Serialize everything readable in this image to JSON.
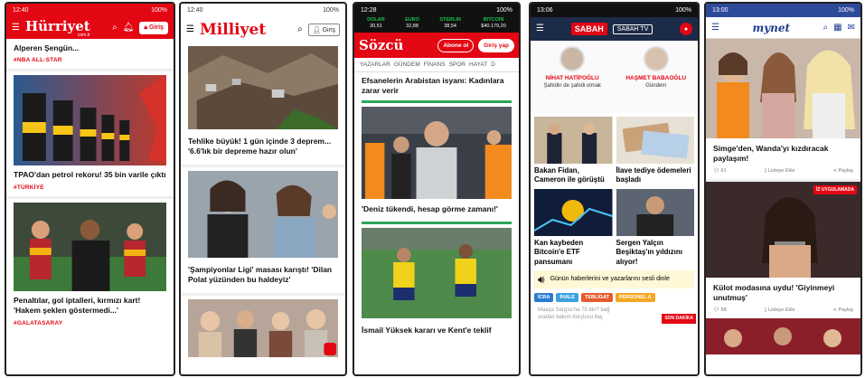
{
  "hurriyet": {
    "status_time": "12:40",
    "status_right": "100%",
    "logo": "Hürriyet",
    "logo_sub": "com.tr",
    "login_label": "Giriş",
    "top_headline": "Alperen Şengün...",
    "top_tag": "#NBA ALL-STAR",
    "story1_headline": "TPAO'dan petrol rekoru! 35 bin varile çıktı",
    "story1_tag": "#TÜRKİYE",
    "story2_headline": "Penaltılar, gol iptalleri, kırmızı kart! 'Hakem şeklen göstermedi...'",
    "story2_tag": "#GALATASARAY"
  },
  "milliyet": {
    "status_time": "12:40",
    "status_right": "100%",
    "logo": "Milliyet",
    "login_label": "Giriş",
    "story1_headline": "Tehlike büyük! 1 gün içinde 3 deprem... '6.6'lık bir depreme hazır olun'",
    "story2_headline": "'Şampiyonlar Ligi' masası karıştı! 'Dilan Polat yüzünden bu haldeyiz'"
  },
  "sozcu": {
    "status_time": "12:28",
    "status_right": "100%",
    "ticker": [
      {
        "name": "DOLAR",
        "value": "30,51"
      },
      {
        "name": "EURO",
        "value": "32,88"
      },
      {
        "name": "STERLIN",
        "value": "38,54"
      },
      {
        "name": "BITCOIN",
        "value": "$40.179,20"
      }
    ],
    "logo": "Sözcü",
    "subscribe_label": "Abone ol",
    "login_label": "Giriş yap",
    "nav": [
      "YAZARLAR",
      "GÜNDEM",
      "FİNANS",
      "SPOR",
      "HAYAT",
      "D"
    ],
    "top_headline": "Efsanelerin Arabistan isyanı: Kadınlara zarar verir",
    "story1_headline": "'Deniz tükendi, hesap görme zamanı!'",
    "story2_headline": "İsmail Yüksek kararı ve Kent'e teklif"
  },
  "sabah": {
    "status_time": "13:06",
    "status_right": "100%",
    "logo": "SABAH",
    "tv_label": "SABAH TV",
    "authors": [
      {
        "name": "NİHAT HATİPOĞLU",
        "title": "Şahidin de şahidi olmak"
      },
      {
        "name": "HAŞMET BABAOĞLU",
        "title": "Gündem"
      }
    ],
    "cards": [
      {
        "title": "Bakan Fidan, Cameron ile görüştü"
      },
      {
        "title": "İlave tediye ödemeleri başladı"
      },
      {
        "title": "Kan kaybeden Bitcoin'e ETF pansumanı"
      },
      {
        "title": "Sergen Yalçın Beşiktaş'ın yıldızını alıyor!"
      }
    ],
    "audio_text": "Günün haberlerini ve yazarlarını sesli dinle",
    "chips": [
      "İCRA",
      "İHALE",
      "TEBLİGAT",
      "PERSONEL A"
    ],
    "bottom_text": "Maaşa Sargısı'na 75 bin? bağ",
    "bottom_sub": "oradan bakım borçlusu ilaç",
    "bottom_badge": "SON DAKİKA"
  },
  "mynet": {
    "status_time": "13:00",
    "status_right": "100%",
    "logo": "mynet",
    "story1_headline": "Simge'den, Wanda'yı kızdıracak paylaşım!",
    "story1_meta": {
      "count": "61",
      "like": "Listeye Ekle",
      "share": "Paylaş"
    },
    "story2_badge": "İZ UYGULAMADA",
    "story2_headline": "Külot modasına uydu! 'Giyinmeyi unutmuş'",
    "story2_meta": {
      "count": "58",
      "like": "Listeye Ekle",
      "share": "Paylaş"
    }
  },
  "colors": {
    "hurriyet_red": "#e30613",
    "sozcu_red": "#e30613",
    "sabah_navy": "#1c2b47",
    "mynet_blue": "#1d3c8f",
    "sozcu_green": "#2ea65a"
  }
}
